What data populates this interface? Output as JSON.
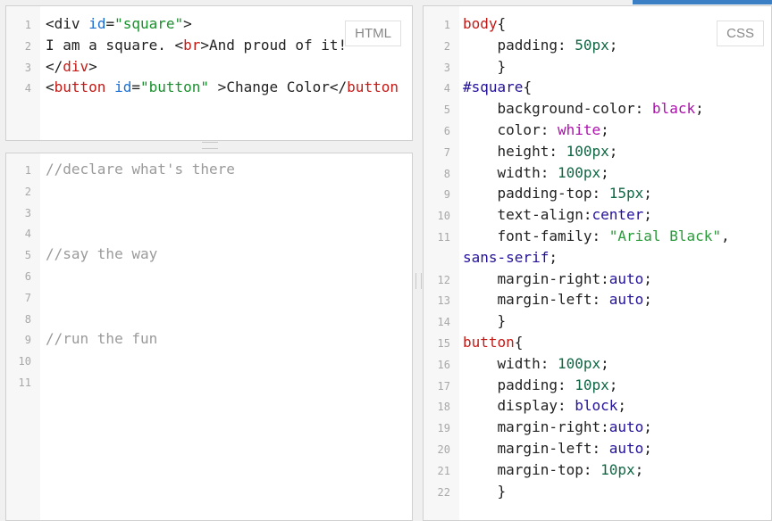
{
  "html_panel": {
    "badge": "HTML",
    "lines": [
      {
        "num": "1",
        "tokens": [
          {
            "t": "<",
            "c": ""
          },
          {
            "t": "div",
            "c": ""
          },
          {
            "t": " ",
            "c": ""
          },
          {
            "t": "id",
            "c": "t-attr"
          },
          {
            "t": "=",
            "c": ""
          },
          {
            "t": "\"square\"",
            "c": "t-str"
          },
          {
            "t": ">",
            "c": ""
          }
        ]
      },
      {
        "num": "2",
        "tokens": [
          {
            "t": "I am a square. <",
            "c": ""
          },
          {
            "t": "br",
            "c": "t-tag"
          },
          {
            "t": ">And proud of it!",
            "c": ""
          }
        ]
      },
      {
        "num": "3",
        "tokens": [
          {
            "t": "</",
            "c": ""
          },
          {
            "t": "div",
            "c": "t-tag"
          },
          {
            "t": ">",
            "c": ""
          }
        ]
      },
      {
        "num": "4",
        "tokens": [
          {
            "t": "<",
            "c": ""
          },
          {
            "t": "button",
            "c": "t-tag"
          },
          {
            "t": " ",
            "c": ""
          },
          {
            "t": "id",
            "c": "t-attr"
          },
          {
            "t": "=",
            "c": ""
          },
          {
            "t": "\"button\"",
            "c": "t-str"
          },
          {
            "t": " >Change Color</",
            "c": ""
          },
          {
            "t": "button",
            "c": "t-tag"
          }
        ]
      }
    ]
  },
  "js_panel": {
    "lines": [
      {
        "num": "1",
        "tokens": [
          {
            "t": "//declare what's there",
            "c": "t-cmt"
          }
        ]
      },
      {
        "num": "2",
        "tokens": []
      },
      {
        "num": "3",
        "tokens": []
      },
      {
        "num": "4",
        "tokens": []
      },
      {
        "num": "5",
        "tokens": [
          {
            "t": "//say the way",
            "c": "t-cmt"
          }
        ]
      },
      {
        "num": "6",
        "tokens": []
      },
      {
        "num": "7",
        "tokens": []
      },
      {
        "num": "8",
        "tokens": []
      },
      {
        "num": "9",
        "tokens": [
          {
            "t": "//run the fun",
            "c": "t-cmt"
          }
        ]
      },
      {
        "num": "10",
        "tokens": []
      },
      {
        "num": "11",
        "tokens": []
      }
    ]
  },
  "css_panel": {
    "badge": "CSS",
    "lines": [
      {
        "num": "1",
        "tokens": [
          {
            "t": "body",
            "c": "t-sel"
          },
          {
            "t": "{",
            "c": ""
          }
        ]
      },
      {
        "num": "2",
        "tokens": [
          {
            "t": "    padding: ",
            "c": ""
          },
          {
            "t": "50px",
            "c": "t-num"
          },
          {
            "t": ";",
            "c": ""
          }
        ]
      },
      {
        "num": "3",
        "tokens": [
          {
            "t": "    }",
            "c": ""
          }
        ]
      },
      {
        "num": "4",
        "tokens": [
          {
            "t": "#square",
            "c": "t-kw"
          },
          {
            "t": "{",
            "c": ""
          }
        ]
      },
      {
        "num": "5",
        "tokens": [
          {
            "t": "    background-color: ",
            "c": ""
          },
          {
            "t": "black",
            "c": "t-col"
          },
          {
            "t": ";",
            "c": ""
          }
        ]
      },
      {
        "num": "6",
        "tokens": [
          {
            "t": "    color: ",
            "c": ""
          },
          {
            "t": "white",
            "c": "t-col"
          },
          {
            "t": ";",
            "c": ""
          }
        ]
      },
      {
        "num": "7",
        "tokens": [
          {
            "t": "    height: ",
            "c": ""
          },
          {
            "t": "100px",
            "c": "t-num"
          },
          {
            "t": ";",
            "c": ""
          }
        ]
      },
      {
        "num": "8",
        "tokens": [
          {
            "t": "    width: ",
            "c": ""
          },
          {
            "t": "100px",
            "c": "t-num"
          },
          {
            "t": ";",
            "c": ""
          }
        ]
      },
      {
        "num": "9",
        "tokens": [
          {
            "t": "    padding-top: ",
            "c": ""
          },
          {
            "t": "15px",
            "c": "t-num"
          },
          {
            "t": ";",
            "c": ""
          }
        ]
      },
      {
        "num": "10",
        "tokens": [
          {
            "t": "    text-align:",
            "c": ""
          },
          {
            "t": "center",
            "c": "t-kw"
          },
          {
            "t": ";",
            "c": ""
          }
        ]
      },
      {
        "num": "11",
        "tokens": [
          {
            "t": "    font-family: ",
            "c": ""
          },
          {
            "t": "\"Arial Black\"",
            "c": "t-strc"
          },
          {
            "t": ",",
            "c": ""
          }
        ]
      },
      {
        "num": "",
        "tokens": [
          {
            "t": "sans-serif",
            "c": "t-kw"
          },
          {
            "t": ";",
            "c": ""
          }
        ]
      },
      {
        "num": "12",
        "tokens": [
          {
            "t": "    margin-right:",
            "c": ""
          },
          {
            "t": "auto",
            "c": "t-kw"
          },
          {
            "t": ";",
            "c": ""
          }
        ]
      },
      {
        "num": "13",
        "tokens": [
          {
            "t": "    margin-left: ",
            "c": ""
          },
          {
            "t": "auto",
            "c": "t-kw"
          },
          {
            "t": ";",
            "c": ""
          }
        ]
      },
      {
        "num": "14",
        "tokens": [
          {
            "t": "    }",
            "c": ""
          }
        ]
      },
      {
        "num": "15",
        "tokens": [
          {
            "t": "button",
            "c": "t-sel"
          },
          {
            "t": "{",
            "c": ""
          }
        ]
      },
      {
        "num": "16",
        "tokens": [
          {
            "t": "    width: ",
            "c": ""
          },
          {
            "t": "100px",
            "c": "t-num"
          },
          {
            "t": ";",
            "c": ""
          }
        ]
      },
      {
        "num": "17",
        "tokens": [
          {
            "t": "    padding: ",
            "c": ""
          },
          {
            "t": "10px",
            "c": "t-num"
          },
          {
            "t": ";",
            "c": ""
          }
        ]
      },
      {
        "num": "18",
        "tokens": [
          {
            "t": "    display: ",
            "c": ""
          },
          {
            "t": "block",
            "c": "t-kw"
          },
          {
            "t": ";",
            "c": ""
          }
        ]
      },
      {
        "num": "19",
        "tokens": [
          {
            "t": "    margin-right:",
            "c": ""
          },
          {
            "t": "auto",
            "c": "t-kw"
          },
          {
            "t": ";",
            "c": ""
          }
        ]
      },
      {
        "num": "20",
        "tokens": [
          {
            "t": "    margin-left: ",
            "c": ""
          },
          {
            "t": "auto",
            "c": "t-kw"
          },
          {
            "t": ";",
            "c": ""
          }
        ]
      },
      {
        "num": "21",
        "tokens": [
          {
            "t": "    margin-top: ",
            "c": ""
          },
          {
            "t": "10px",
            "c": "t-num"
          },
          {
            "t": ";",
            "c": ""
          }
        ]
      },
      {
        "num": "22",
        "tokens": [
          {
            "t": "    }",
            "c": ""
          }
        ]
      }
    ]
  }
}
